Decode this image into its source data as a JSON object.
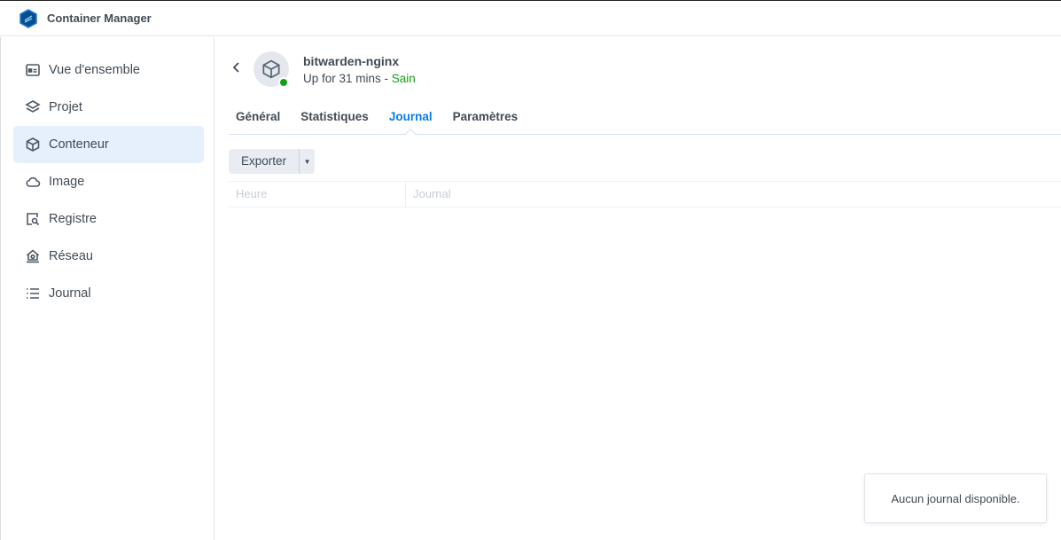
{
  "app": {
    "title": "Container Manager"
  },
  "sidebar": {
    "items": [
      {
        "label": "Vue d'ensemble",
        "icon": "overview-icon"
      },
      {
        "label": "Projet",
        "icon": "layers-icon"
      },
      {
        "label": "Conteneur",
        "icon": "cube-icon"
      },
      {
        "label": "Image",
        "icon": "cloud-icon"
      },
      {
        "label": "Registre",
        "icon": "registry-search-icon"
      },
      {
        "label": "Réseau",
        "icon": "network-icon"
      },
      {
        "label": "Journal",
        "icon": "list-icon"
      }
    ],
    "active": "Conteneur"
  },
  "container": {
    "name": "bitwarden-nginx",
    "uptime": "Up for 31 mins - ",
    "health": "Sain"
  },
  "tabs": [
    "Général",
    "Statistiques",
    "Journal",
    "Paramètres"
  ],
  "toolbar": {
    "export_label": "Exporter"
  },
  "table": {
    "columns": [
      "Heure",
      "Journal"
    ]
  },
  "toast": {
    "message": "Aucun journal disponible."
  }
}
